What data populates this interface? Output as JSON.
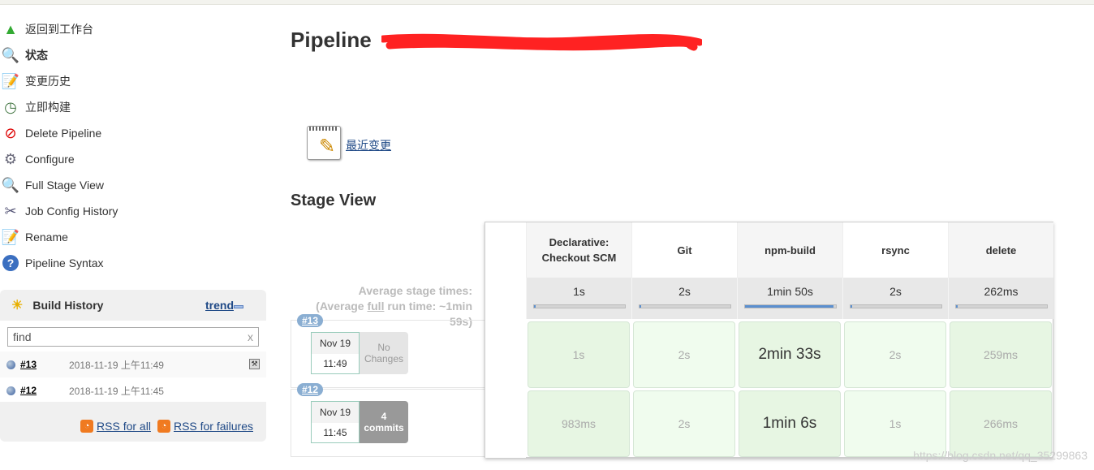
{
  "sidebar": {
    "items": [
      {
        "label": "返回到工作台",
        "icon": "up-arrow-icon"
      },
      {
        "label": "状态",
        "icon": "search-icon"
      },
      {
        "label": "变更历史",
        "icon": "notepad-icon"
      },
      {
        "label": "立即构建",
        "icon": "clock-build-icon"
      },
      {
        "label": "Delete Pipeline",
        "icon": "no-entry-icon"
      },
      {
        "label": "Configure",
        "icon": "gear-icon"
      },
      {
        "label": "Full Stage View",
        "icon": "search-icon"
      },
      {
        "label": "Job Config History",
        "icon": "tools-icon"
      },
      {
        "label": "Rename",
        "icon": "notepad-icon"
      },
      {
        "label": "Pipeline Syntax",
        "icon": "help-icon"
      }
    ]
  },
  "build_history": {
    "title": "Build History",
    "trend": "trend",
    "find_placeholder": "find",
    "clear": "x",
    "builds": [
      {
        "id": "#13",
        "time": "2018-11-19 上午11:49"
      },
      {
        "id": "#12",
        "time": "2018-11-19 上午11:45"
      }
    ],
    "rss_all": "RSS for all",
    "rss_failures": "RSS for failures"
  },
  "page": {
    "title": "Pipeline",
    "recent_changes": "最近变更",
    "stage_view": "Stage View"
  },
  "stage_view": {
    "avg_label": "Average stage times:",
    "avg_full_pre": "(Average ",
    "avg_full_link": "full",
    "avg_full_post": " run time: ~1min 59s)",
    "stages": [
      {
        "name": "Declarative: Checkout SCM",
        "avg": "1s",
        "avg_fraction": 0.01
      },
      {
        "name": "Git",
        "avg": "2s",
        "avg_fraction": 0.02
      },
      {
        "name": "npm-build",
        "avg": "1min 50s",
        "avg_fraction": 0.98
      },
      {
        "name": "rsync",
        "avg": "2s",
        "avg_fraction": 0.02
      },
      {
        "name": "delete",
        "avg": "262ms",
        "avg_fraction": 0.005
      }
    ],
    "runs": [
      {
        "id": "#13",
        "date": "Nov 19",
        "time": "11:49",
        "changes_line1": "No",
        "changes_line2": "Changes",
        "changes_type": "none",
        "durations": [
          "1s",
          "2s",
          "2min 33s",
          "2s",
          "259ms"
        ]
      },
      {
        "id": "#12",
        "date": "Nov 19",
        "time": "11:45",
        "changes_line1": "4",
        "changes_line2": "commits",
        "changes_type": "some",
        "durations": [
          "983ms",
          "2s",
          "1min 6s",
          "1s",
          "266ms"
        ]
      }
    ]
  },
  "watermark": "https://blog.csdn.net/qq_35299863"
}
